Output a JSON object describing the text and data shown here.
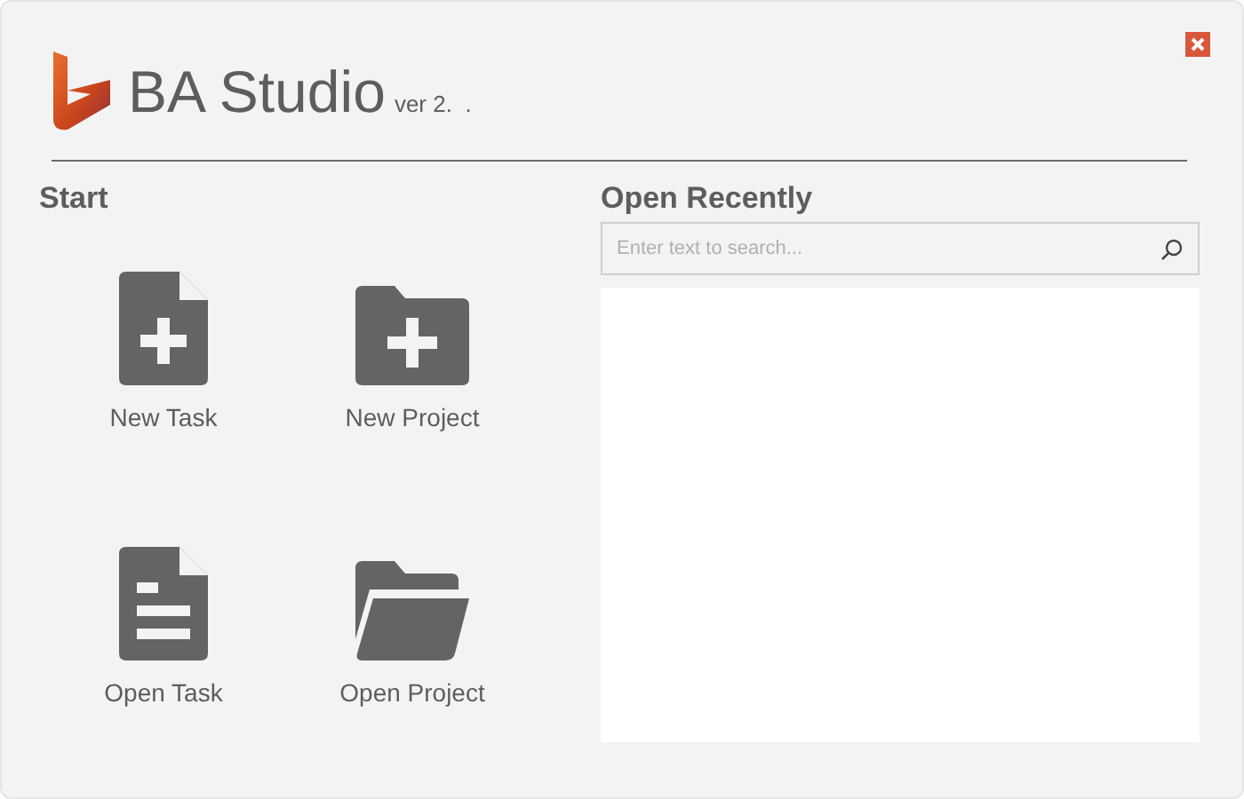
{
  "app": {
    "title": "BA Studio",
    "version": "ver 2.  ."
  },
  "start": {
    "heading": "Start",
    "actions": [
      {
        "kind": "new-file",
        "label": "New Task"
      },
      {
        "kind": "new-folder",
        "label": "New Project"
      },
      {
        "kind": "open-file",
        "label": "Open Task"
      },
      {
        "kind": "open-folder",
        "label": "Open Project"
      }
    ]
  },
  "recent": {
    "heading": "Open Recently",
    "search": {
      "placeholder": "Enter text to search..."
    }
  }
}
